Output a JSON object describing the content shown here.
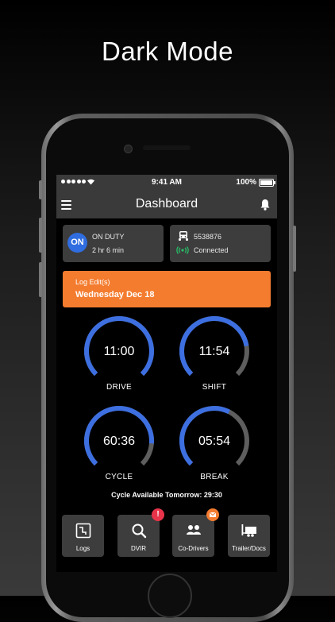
{
  "headline": "Dark Mode",
  "status_bar": {
    "time": "9:41 AM",
    "battery": "100%"
  },
  "nav": {
    "title": "Dashboard"
  },
  "duty_card": {
    "badge": "ON",
    "status": "ON DUTY",
    "duration": "2 hr 6 min"
  },
  "vehicle_card": {
    "vehicle_id": "5538876",
    "connection": "Connected"
  },
  "log_banner": {
    "title": "Log Edit(s)",
    "date": "Wednesday Dec 18"
  },
  "gauges": [
    {
      "label": "DRIVE",
      "value": "11:00",
      "remaining_fraction": 1.0
    },
    {
      "label": "SHIFT",
      "value": "11:54",
      "remaining_fraction": 0.8
    },
    {
      "label": "CYCLE",
      "value": "60:36",
      "remaining_fraction": 0.85
    },
    {
      "label": "BREAK",
      "value": "05:54",
      "remaining_fraction": 0.6
    }
  ],
  "cycle_available": "Cycle Available Tomorrow: 29:30",
  "tiles": [
    {
      "label": "Logs",
      "icon": "logs-icon"
    },
    {
      "label": "DVIR",
      "icon": "search-icon",
      "badge": "!"
    },
    {
      "label": "Co-Drivers",
      "icon": "users-icon",
      "badge": "mail"
    },
    {
      "label": "Trailer/Docs",
      "icon": "trailer-icon"
    }
  ],
  "colors": {
    "accent_blue": "#3d6fe0",
    "accent_orange": "#f47c2f",
    "alert_red": "#e8344a",
    "connected_green": "#27c26a",
    "track_gray": "#5e5e5e",
    "card_gray": "#3d3d3d"
  }
}
